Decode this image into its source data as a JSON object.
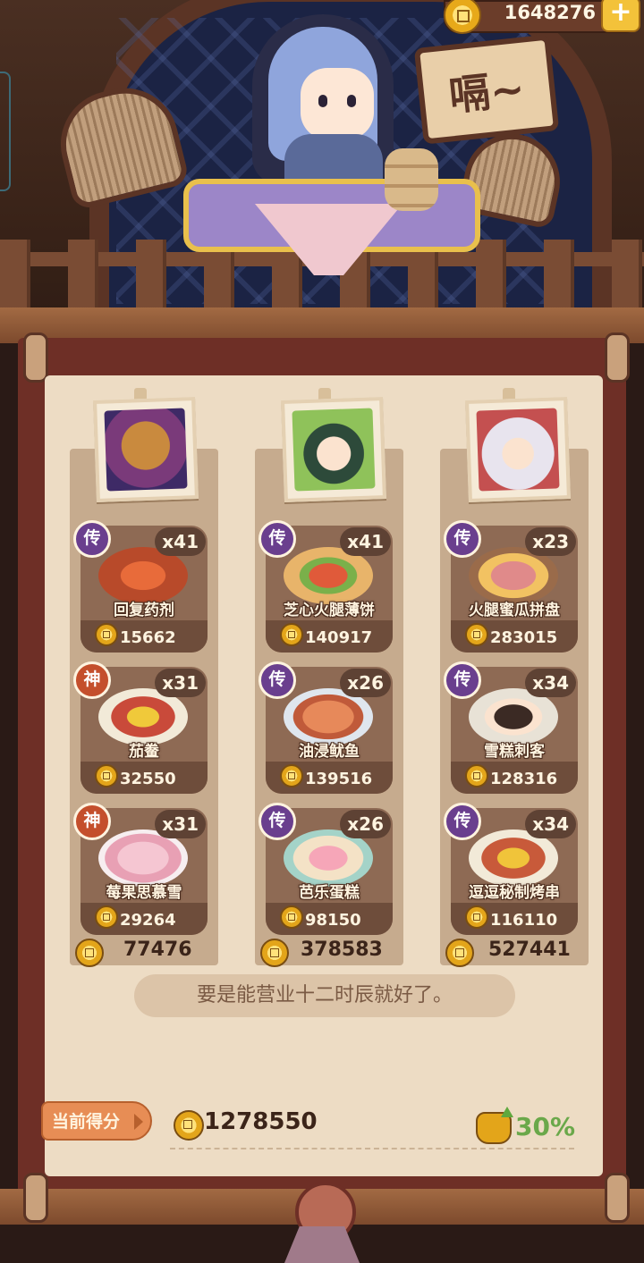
{
  "header": {
    "coins": "1648276",
    "plus_symbol": "+",
    "speech_text": "嗝~"
  },
  "restaurants": [
    {
      "total": "77476",
      "dishes": [
        {
          "rarity": "传",
          "name": "回复药剂",
          "count": "x41",
          "price": "15662"
        },
        {
          "rarity": "神",
          "name": "茄鲞",
          "count": "x31",
          "price": "32550"
        },
        {
          "rarity": "神",
          "name": "莓果思慕雪",
          "count": "x31",
          "price": "29264"
        }
      ]
    },
    {
      "total": "378583",
      "dishes": [
        {
          "rarity": "传",
          "name": "芝心火腿薄饼",
          "count": "x41",
          "price": "140917"
        },
        {
          "rarity": "传",
          "name": "油浸鱿鱼",
          "count": "x26",
          "price": "139516"
        },
        {
          "rarity": "传",
          "name": "芭乐蛋糕",
          "count": "x26",
          "price": "98150"
        }
      ]
    },
    {
      "total": "527441",
      "dishes": [
        {
          "rarity": "传",
          "name": "火腿蜜瓜拼盘",
          "count": "x23",
          "price": "283015"
        },
        {
          "rarity": "传",
          "name": "雪糕刺客",
          "count": "x34",
          "price": "128316"
        },
        {
          "rarity": "传",
          "name": "逗逗秘制烤串",
          "count": "x34",
          "price": "116110"
        }
      ]
    }
  ],
  "quote": "要是能营业十二时辰就好了。",
  "score": {
    "label": "当前得分",
    "value": "1278550",
    "boost": "30%"
  },
  "colors": {
    "rarity_legendary": "#6a3f8e",
    "rarity_divine": "#c44f2c",
    "boost_green": "#6aa84a"
  }
}
